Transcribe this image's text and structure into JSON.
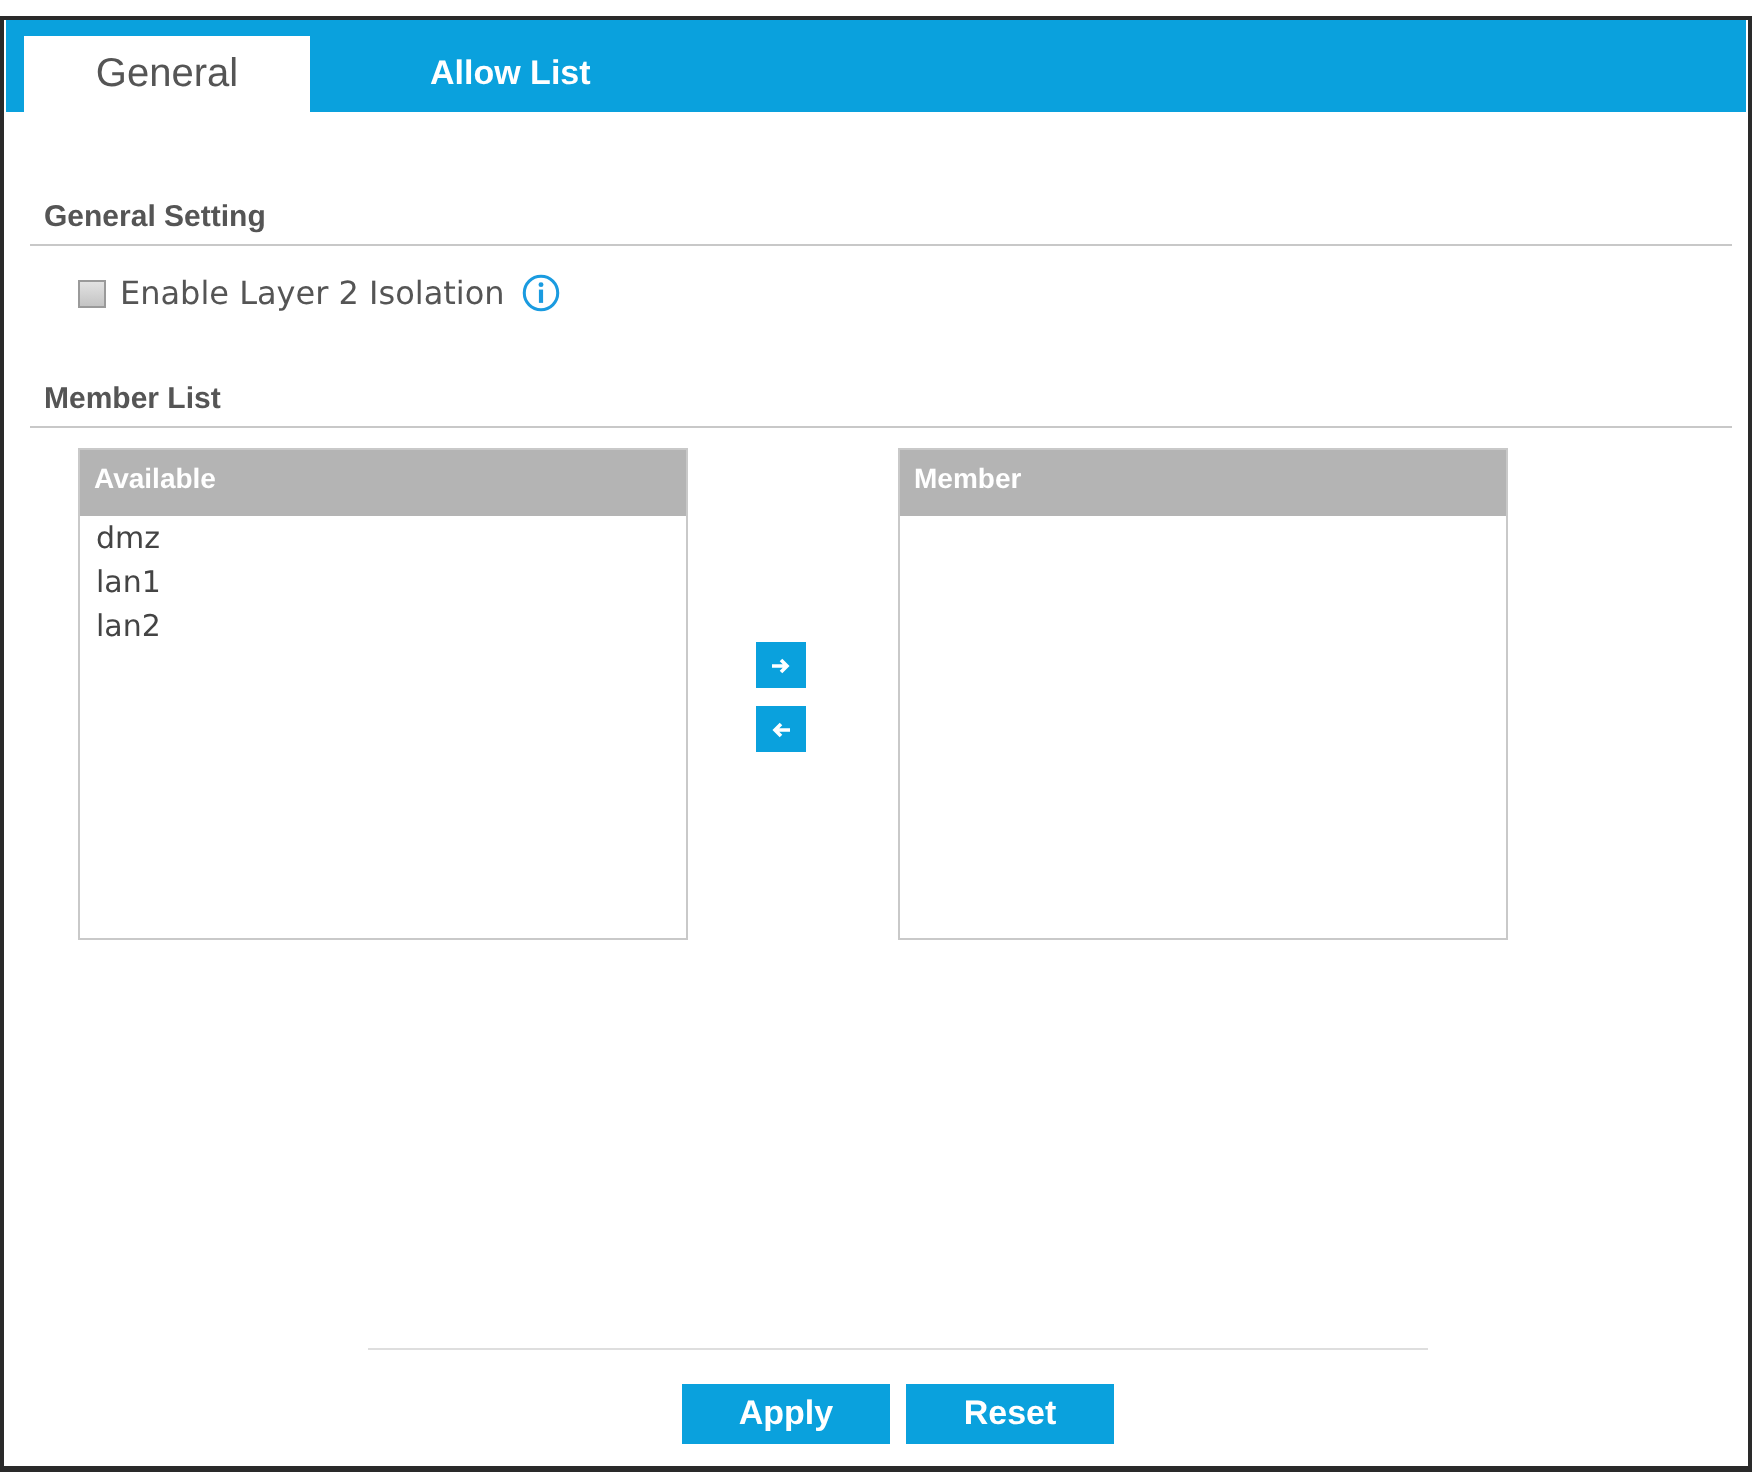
{
  "tabs": [
    {
      "label": "General",
      "selected": true
    },
    {
      "label": "Allow List",
      "selected": false
    }
  ],
  "general_setting": {
    "heading": "General Setting",
    "isolation": {
      "label": "Enable Layer 2 Isolation",
      "checked": false
    }
  },
  "member_list": {
    "heading": "Member List",
    "available": {
      "header": "Available",
      "items": [
        {
          "label": "dmz",
          "selected": false
        },
        {
          "label": "lan1",
          "selected": false
        },
        {
          "label": "lan2",
          "selected": false
        }
      ]
    },
    "member": {
      "header": "Member"
    }
  },
  "buttons": [
    "Apply",
    "Reset"
  ]
}
